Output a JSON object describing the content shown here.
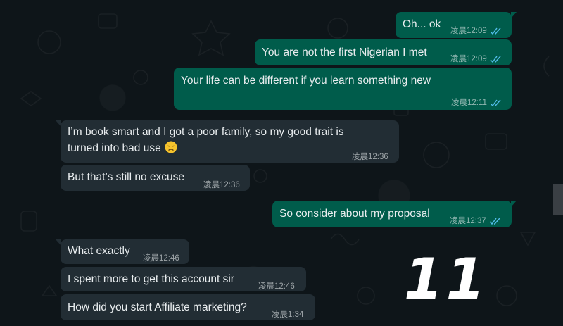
{
  "messages": [
    {
      "dir": "out",
      "text": "Oh... ok",
      "time": "凌晨12:09",
      "read": true
    },
    {
      "dir": "out",
      "text": "You are not the first Nigerian I met",
      "time": "凌晨12:09",
      "read": true
    },
    {
      "dir": "out",
      "text": "Your life can be different if you learn something new",
      "time": "凌晨12:11",
      "read": true
    },
    {
      "dir": "in",
      "text_line1": "I’m book smart and I got a poor family, so my good trait is",
      "text_line2": "turned into bad use",
      "emoji": "disappointed-face",
      "time": "凌晨12:36"
    },
    {
      "dir": "in",
      "text": "But that’s still no excuse",
      "time": "凌晨12:36"
    },
    {
      "dir": "out",
      "text": "So consider about my proposal",
      "time": "凌晨12:37",
      "read": true
    },
    {
      "dir": "in",
      "text": "What exactly",
      "time": "凌晨12:46"
    },
    {
      "dir": "in",
      "text": "I spent more to get this account sir",
      "time": "凌晨12:46"
    },
    {
      "dir": "in",
      "text": "How did you start Affiliate marketing?",
      "time": "凌晨1:34"
    }
  ],
  "overlay": {
    "number": "11"
  },
  "colors": {
    "outgoing": "#005c4b",
    "incoming": "#222d34",
    "read_tick": "#53bdeb",
    "background": "#0e1519"
  }
}
